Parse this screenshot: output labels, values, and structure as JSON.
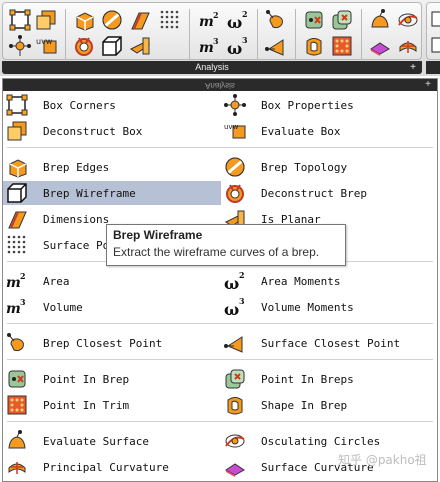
{
  "ribbon": {
    "tab_label": "Analysis",
    "pin_glyph": "+"
  },
  "panel": {
    "header_label": "Analysis",
    "pin_glyph": "+"
  },
  "items": [
    {
      "label": "Box Corners",
      "icon": "box-corners-icon"
    },
    {
      "label": "Box Properties",
      "icon": "box-properties-icon"
    },
    {
      "label": "Deconstruct Box",
      "icon": "deconstruct-box-icon"
    },
    {
      "label": "Evaluate Box",
      "icon": "evaluate-box-icon"
    },
    {
      "label": "Brep Edges",
      "icon": "brep-edges-icon"
    },
    {
      "label": "Brep Topology",
      "icon": "brep-topology-icon"
    },
    {
      "label": "Brep Wireframe",
      "icon": "brep-wireframe-icon"
    },
    {
      "label": "Deconstruct Brep",
      "icon": "deconstruct-brep-icon"
    },
    {
      "label": "Dimensions",
      "icon": "dimensions-icon"
    },
    {
      "label": "Is Planar",
      "icon": "is-planar-icon"
    },
    {
      "label": "Surface Poi",
      "icon": "surface-points-icon"
    },
    {
      "label": "Area",
      "icon": "area-icon",
      "glyph": "m",
      "sup": "2"
    },
    {
      "label": "Area Moments",
      "icon": "area-moments-icon",
      "sup": "2"
    },
    {
      "label": "Volume",
      "icon": "volume-icon",
      "glyph": "m",
      "sup": "3"
    },
    {
      "label": "Volume Moments",
      "icon": "volume-moments-icon",
      "sup": "3"
    },
    {
      "label": "Brep Closest Point",
      "icon": "brep-closest-point-icon"
    },
    {
      "label": "Surface Closest Point",
      "icon": "surface-closest-point-icon"
    },
    {
      "label": "Point In Brep",
      "icon": "point-in-brep-icon"
    },
    {
      "label": "Point In Breps",
      "icon": "point-in-breps-icon"
    },
    {
      "label": "Point In Trim",
      "icon": "point-in-trim-icon"
    },
    {
      "label": "Shape In Brep",
      "icon": "shape-in-brep-icon"
    },
    {
      "label": "Evaluate Surface",
      "icon": "evaluate-surface-icon"
    },
    {
      "label": "Osculating Circles",
      "icon": "osculating-circles-icon"
    },
    {
      "label": "Principal Curvature",
      "icon": "principal-curvature-icon"
    },
    {
      "label": "Surface Curvature",
      "icon": "surface-curvature-icon"
    }
  ],
  "tooltip": {
    "title": "Brep Wireframe",
    "description": "Extract the wireframe curves of a brep."
  },
  "watermark": "知乎 @pakho祖",
  "colors": {
    "selection": "#b6c1d6",
    "icon_orange": "#f59a1e",
    "icon_red": "#d03a1a",
    "tab_bar": "#2a2a2a"
  }
}
